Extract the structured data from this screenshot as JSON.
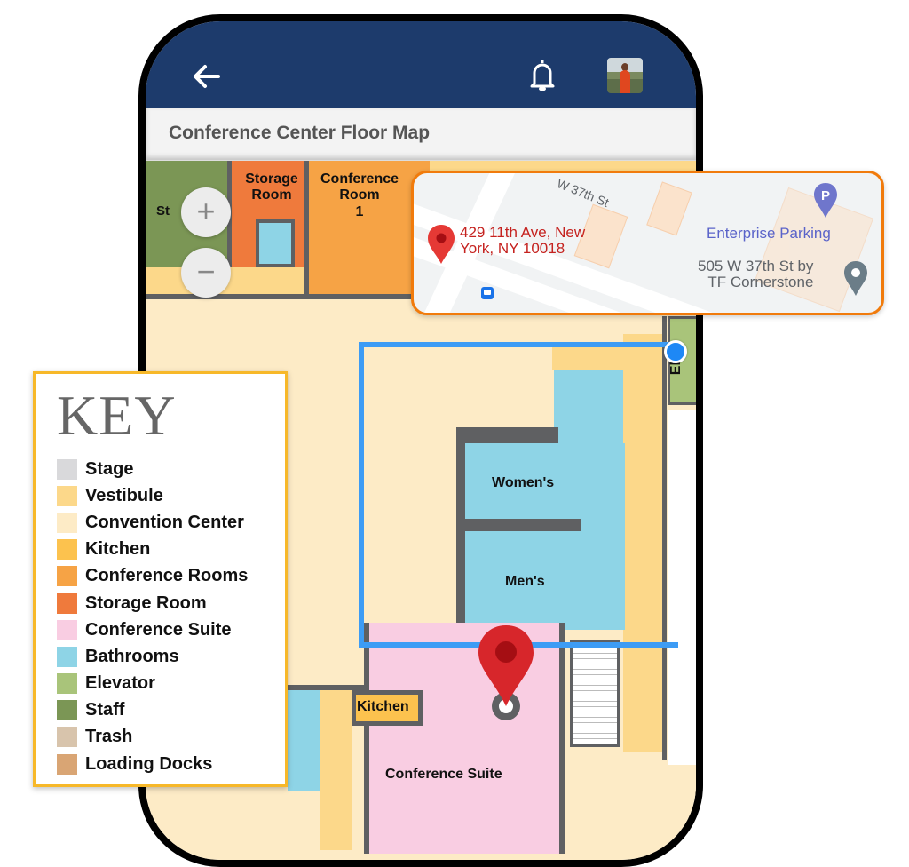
{
  "app_bar": {
    "back_icon": "arrow-left-icon",
    "notification_icon": "bell-icon",
    "avatar_alt": "user-avatar",
    "background_color": "#1d3b6c"
  },
  "page": {
    "title": "Conference Center Floor Map"
  },
  "map": {
    "rooms": {
      "storage": "Storage Room",
      "conference_room_1_line1": "Conference",
      "conference_room_1_line2": "Room",
      "conference_room_1_line3": "1",
      "staff_partial": "St",
      "womens": "Women's",
      "mens": "Men's",
      "kitchen": "Kitchen",
      "conference_suite": "Conference Suite",
      "elevator_partial": "Ele"
    },
    "zoom_in_label": "+",
    "zoom_out_label": "−",
    "route_color": "#3d9cf5",
    "destination_pin_color": "#d7262b"
  },
  "location_card": {
    "address_line1": "429 11th Ave, New",
    "address_line2": "York, NY 10018",
    "street_label": "W 37th St",
    "parking_poi": "Enterprise Parking",
    "parking_icon_letter": "P",
    "poi2_line1": "505 W 37th St by",
    "poi2_line2": "TF Cornerstone",
    "border_color": "#f17b0c"
  },
  "key": {
    "title": "KEY",
    "items": [
      {
        "label": "Stage",
        "color": "#d9d9db"
      },
      {
        "label": "Vestibule",
        "color": "#fcd88a"
      },
      {
        "label": "Convention Center",
        "color": "#fdebc6"
      },
      {
        "label": "Kitchen",
        "color": "#fcc24e"
      },
      {
        "label": "Conference Rooms",
        "color": "#f6a345"
      },
      {
        "label": "Storage Room",
        "color": "#ef7a3c"
      },
      {
        "label": "Conference Suite",
        "color": "#f9cde2"
      },
      {
        "label": "Bathrooms",
        "color": "#8ed4e6"
      },
      {
        "label": "Elevator",
        "color": "#a9c47a"
      },
      {
        "label": "Staff",
        "color": "#7b9655"
      },
      {
        "label": "Trash",
        "color": "#d8c4ac"
      },
      {
        "label": "Loading Docks",
        "color": "#d9a574"
      }
    ]
  }
}
